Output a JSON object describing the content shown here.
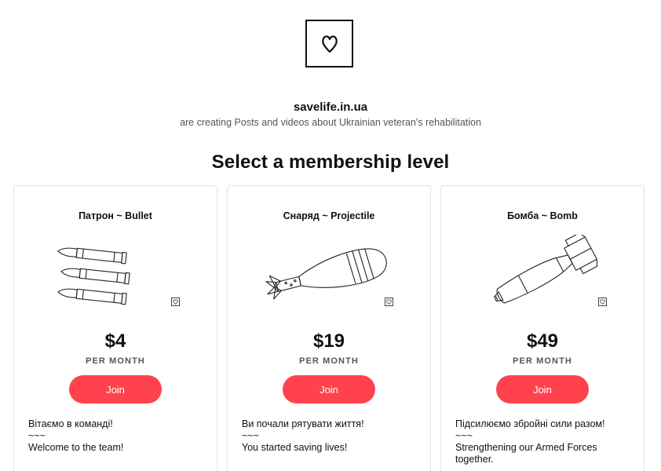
{
  "creator": {
    "name": "savelife.in.ua",
    "description": "are creating Posts and videos about Ukrainian veteran's rehabilitation"
  },
  "section_title": "Select a membership level",
  "tiers": [
    {
      "name": "Патрон ~ Bullet",
      "price": "$4",
      "period": "PER MONTH",
      "join_label": "Join",
      "description_ua": "Вітаємо в команді!",
      "separator": "~~~",
      "description_en": "Welcome to the team!",
      "art_icon": "bullets-illustration"
    },
    {
      "name": "Снаряд ~ Projectile",
      "price": "$19",
      "period": "PER MONTH",
      "join_label": "Join",
      "description_ua": "Ви почали рятувати життя!",
      "separator": "~~~",
      "description_en": "You started saving lives!",
      "art_icon": "mortar-shell-illustration"
    },
    {
      "name": "Бомба ~ Bomb",
      "price": "$49",
      "period": "PER MONTH",
      "join_label": "Join",
      "description_ua": "Підсилюємо збройні сили разом!",
      "separator": "~~~",
      "description_en": "Strengthening our Armed Forces together.",
      "art_icon": "bomb-illustration"
    }
  ],
  "colors": {
    "join_button": "#ff424d",
    "text": "#111111",
    "muted": "#555555"
  }
}
